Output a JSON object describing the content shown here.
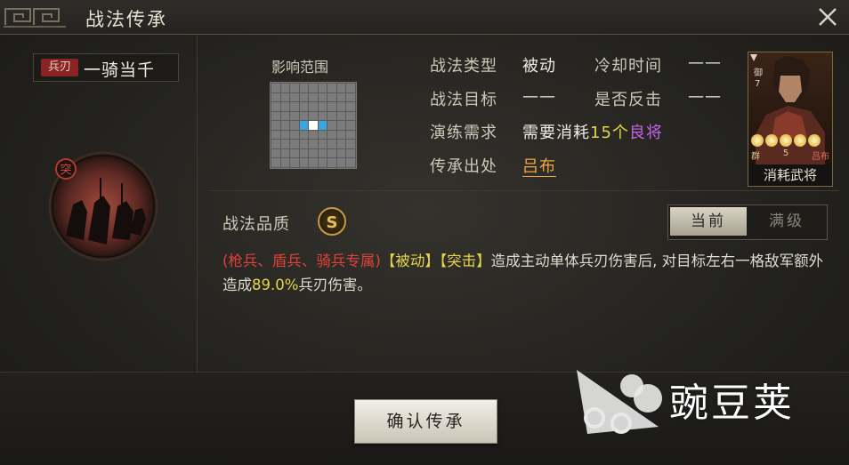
{
  "window": {
    "title": "战法传承",
    "close_icon": "close-icon"
  },
  "skill": {
    "troop_tag": "兵刃",
    "name": "一骑当千",
    "emblem_mark": "突"
  },
  "range": {
    "label": "影响范围",
    "grid": {
      "size": 9,
      "self_cell": [
        4,
        4
      ],
      "target_cells": [
        [
          4,
          3
        ],
        [
          4,
          5
        ]
      ]
    }
  },
  "info": {
    "type_label": "战法类型",
    "type_value": "被动",
    "cooldown_label": "冷却时间",
    "cooldown_value": "——",
    "target_label": "战法目标",
    "target_value": "——",
    "counter_label": "是否反击",
    "counter_value": "——",
    "require_label": "演练需求",
    "require_prefix": "需要消耗",
    "require_count": "15个",
    "require_item": "良将",
    "origin_label": "传承出处",
    "origin_value": "吕布"
  },
  "card": {
    "cost": "7",
    "faction": "群",
    "level": "5",
    "name": "吕布",
    "stars": 5,
    "caption": "消耗武将"
  },
  "quality": {
    "label": "战法品质",
    "grade": "S"
  },
  "toggle": {
    "current": "当前",
    "max": "满级"
  },
  "description": {
    "restriction": "(枪兵、盾兵、骑兵专属)",
    "tag1": "【被动】",
    "tag2": "【突击】",
    "text1": "造成主动单体兵刃伤害后, 对目标左右一格敌军额外造成",
    "rate": "89.0%",
    "text2": "兵刃伤害。"
  },
  "confirm_button": "确认传承",
  "watermark": "豌豆荚",
  "colors": {
    "accent_gold": "#c89a3a",
    "highlight_yellow": "#e6d54a",
    "highlight_purple": "#c264e6",
    "origin_orange": "#f2a43a",
    "restriction_red": "#e0403a",
    "target_blue": "#3aa6e0"
  }
}
